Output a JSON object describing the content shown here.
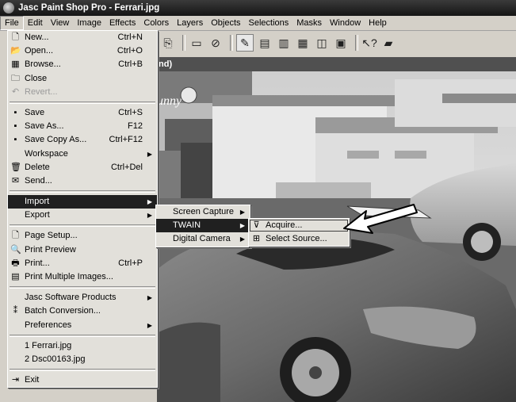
{
  "window": {
    "title": "Jasc Paint Shop Pro - Ferrari.jpg"
  },
  "menubar": [
    "File",
    "Edit",
    "View",
    "Image",
    "Effects",
    "Colors",
    "Layers",
    "Objects",
    "Selections",
    "Masks",
    "Window",
    "Help"
  ],
  "document": {
    "title_fragment": "nd)"
  },
  "toolbar": {
    "icons": [
      "copy-icon",
      "monitor-icon",
      "no-entry-icon",
      "brush-icon",
      "palette-icon",
      "histogram-icon",
      "image-icon",
      "layers-icon",
      "window-icon",
      "help-pointer-icon",
      "camera-icon"
    ]
  },
  "file_menu": {
    "new": "New...",
    "new_sc": "Ctrl+N",
    "open": "Open...",
    "open_sc": "Ctrl+O",
    "browse": "Browse...",
    "browse_sc": "Ctrl+B",
    "close": "Close",
    "revert": "Revert...",
    "save": "Save",
    "save_sc": "Ctrl+S",
    "save_as": "Save As...",
    "save_as_sc": "F12",
    "save_copy_as": "Save Copy As...",
    "save_copy_as_sc": "Ctrl+F12",
    "workspace": "Workspace",
    "delete": "Delete",
    "delete_sc": "Ctrl+Del",
    "send": "Send...",
    "import": "Import",
    "export": "Export",
    "page_setup": "Page Setup...",
    "print_preview": "Print Preview",
    "print": "Print...",
    "print_sc": "Ctrl+P",
    "print_multiple": "Print Multiple Images...",
    "jasc_products": "Jasc Software Products",
    "batch_conversion": "Batch Conversion...",
    "preferences": "Preferences",
    "recent1": "1 Ferrari.jpg",
    "recent2": "2 Dsc00163.jpg",
    "exit": "Exit"
  },
  "import_menu": {
    "screen_capture": "Screen Capture",
    "twain": "TWAIN",
    "digital_camera": "Digital Camera"
  },
  "twain_menu": {
    "acquire": "Acquire...",
    "select_source": "Select Source..."
  },
  "signage": {
    "shop_sign": "unny"
  }
}
